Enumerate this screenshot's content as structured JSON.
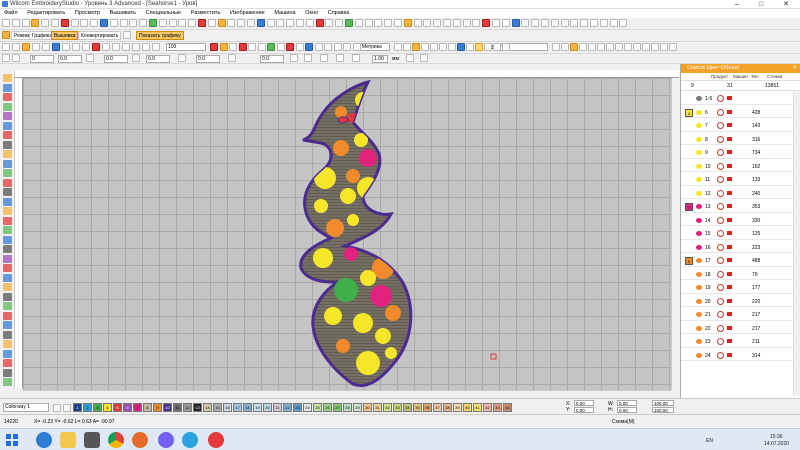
{
  "window": {
    "title": "Wilcom EmbroideryStudio - Уровень 3 Advanced - [Seahorse1 - Уров]",
    "minimize_icon": "minimize-icon",
    "maximize_icon": "maximize-icon",
    "close_icon": "close-icon"
  },
  "menu": [
    "Файл",
    "Редактировать",
    "Просмотр",
    "Вышивать",
    "Специальные",
    "Разместить",
    "Изображение",
    "Машина",
    "Окно",
    "Справка"
  ],
  "toolbar2": {
    "modes": [
      "Режим",
      "Графика",
      "Вышивка",
      "Конвертировать"
    ],
    "show_graphics": "Показать графику",
    "zoom_value": "100",
    "units_label": "Метрика",
    "no_label": "Нет"
  },
  "toolbar3": {
    "fields": [
      "0",
      "0.0",
      "0.0",
      "0.0",
      "0.0",
      "0.0"
    ],
    "density_value": "1.00",
    "unit": "мм"
  },
  "panel": {
    "title": "Список Цвет-Объект",
    "columns": [
      "Продукт",
      "Машин",
      "Тип",
      "Стежки"
    ],
    "summary": {
      "count": "9",
      "range": "31",
      "stitches": "13851"
    },
    "rows": [
      {
        "num": "1-5",
        "stitch": "",
        "color": "#7a7a7a",
        "shape": "gray"
      },
      {
        "num": "6",
        "stitch": "428",
        "color": "#f5e62a",
        "swatch": "4",
        "swatchColor": "#f5e62a"
      },
      {
        "num": "7",
        "stitch": "143",
        "color": "#f5e62a"
      },
      {
        "num": "8",
        "stitch": "316",
        "color": "#f5e62a"
      },
      {
        "num": "9",
        "stitch": "734",
        "color": "#f5e62a"
      },
      {
        "num": "10",
        "stitch": "162",
        "color": "#f5e62a"
      },
      {
        "num": "11",
        "stitch": "133",
        "color": "#f5e62a"
      },
      {
        "num": "12",
        "stitch": "240",
        "color": "#f5e62a"
      },
      {
        "num": "13",
        "stitch": "353",
        "color": "#e0217d",
        "swatch": "7",
        "swatchColor": "#e0217d"
      },
      {
        "num": "14",
        "stitch": "330",
        "color": "#e0217d"
      },
      {
        "num": "15",
        "stitch": "125",
        "color": "#e0217d"
      },
      {
        "num": "16",
        "stitch": "223",
        "color": "#e0217d"
      },
      {
        "num": "17",
        "stitch": "488",
        "color": "#f08a2a",
        "swatch": "9",
        "swatchColor": "#f08a2a"
      },
      {
        "num": "18",
        "stitch": "79",
        "color": "#f08a2a"
      },
      {
        "num": "19",
        "stitch": "177",
        "color": "#f08a2a"
      },
      {
        "num": "20",
        "stitch": "220",
        "color": "#f08a2a"
      },
      {
        "num": "21",
        "stitch": "217",
        "color": "#f08a2a"
      },
      {
        "num": "22",
        "stitch": "217",
        "color": "#f08a2a"
      },
      {
        "num": "23",
        "stitch": "211",
        "color": "#f08a2a"
      },
      {
        "num": "24",
        "stitch": "314",
        "color": "#f08a2a"
      }
    ]
  },
  "colorway": {
    "label": "Colorway 1"
  },
  "palette": [
    {
      "n": "1",
      "c": "#1a3f8f"
    },
    {
      "n": "2",
      "c": "#2b9fd9"
    },
    {
      "n": "3",
      "c": "#3fb049"
    },
    {
      "n": "4",
      "c": "#f5e62a"
    },
    {
      "n": "5",
      "c": "#e53935"
    },
    {
      "n": "6",
      "c": "#9c4fb5"
    },
    {
      "n": "7",
      "c": "#e0217d"
    },
    {
      "n": "8",
      "c": "#c7b89a"
    },
    {
      "n": "9",
      "c": "#f08a2a"
    },
    {
      "n": "10",
      "c": "#4a2f8a"
    },
    {
      "n": "11",
      "c": "#6d6d6d"
    },
    {
      "n": "12",
      "c": "#999999"
    },
    {
      "n": "13",
      "c": "#222222"
    },
    {
      "n": "14",
      "c": "#d1c7b3"
    },
    {
      "n": "15",
      "c": "#b0b0b0"
    },
    {
      "n": "16",
      "c": "#c8d6e5"
    },
    {
      "n": "17",
      "c": "#a5c8e4"
    },
    {
      "n": "18",
      "c": "#89b6dc"
    },
    {
      "n": "19",
      "c": "#c2e2f2"
    },
    {
      "n": "20",
      "c": "#b9d8e8"
    },
    {
      "n": "21",
      "c": "#d6c8e0"
    },
    {
      "n": "22",
      "c": "#7fb2d6"
    },
    {
      "n": "23",
      "c": "#5f9fc9"
    },
    {
      "n": "24",
      "c": "#e6e6e6"
    },
    {
      "n": "25",
      "c": "#c9e4a0"
    },
    {
      "n": "26",
      "c": "#9fd48a"
    },
    {
      "n": "27",
      "c": "#7fc96f"
    },
    {
      "n": "28",
      "c": "#b5e0c5"
    },
    {
      "n": "29",
      "c": "#cbe9d4"
    },
    {
      "n": "30",
      "c": "#f2c48d"
    },
    {
      "n": "31",
      "c": "#e8d49a"
    },
    {
      "n": "32",
      "c": "#d8e08a"
    },
    {
      "n": "33",
      "c": "#c7d77a"
    },
    {
      "n": "34",
      "c": "#b8c77a"
    },
    {
      "n": "35",
      "c": "#e9c27a"
    },
    {
      "n": "36",
      "c": "#d9a86c"
    },
    {
      "n": "37",
      "c": "#f0c9a8"
    },
    {
      "n": "38",
      "c": "#e2b58c"
    },
    {
      "n": "39",
      "c": "#f2e0a8"
    },
    {
      "n": "40",
      "c": "#f6d36a"
    },
    {
      "n": "41",
      "c": "#f7e06a"
    },
    {
      "n": "42",
      "c": "#f3b6a8"
    },
    {
      "n": "43",
      "c": "#e89a7a"
    },
    {
      "n": "44",
      "c": "#c98c6a"
    }
  ],
  "position": {
    "x_label": "X:",
    "x": "0.00",
    "y_label": "Y:",
    "y": "0.00",
    "w_label": "W:",
    "w": "0.00",
    "h_label": "H:",
    "h": "0.00",
    "scale_x": "100.00",
    "scale_y": "100.00"
  },
  "status": {
    "stitch_count": "14220",
    "coords": "X= -0.23 Y= -0.62 L= 0.63 A= -90.97",
    "mode": "Схема(М)"
  },
  "taskbar": {
    "lang": "EN",
    "time": "15:36",
    "date": "14.07.2020"
  },
  "colors": {
    "accent": "#f4a12a",
    "canvas": "#c4c4c4",
    "outline": "#4b2b8f"
  }
}
